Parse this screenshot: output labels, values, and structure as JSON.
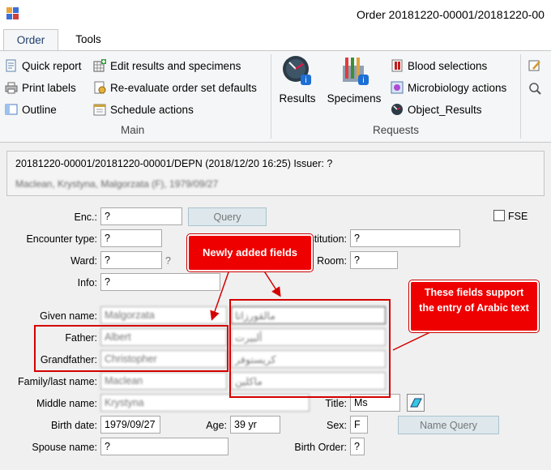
{
  "window": {
    "title": "Order 20181220-00001/20181220-00"
  },
  "tabs": [
    {
      "label": "Order"
    },
    {
      "label": "Tools"
    }
  ],
  "ribbon": {
    "main": {
      "label": "Main",
      "items": [
        "Quick report",
        "Print labels",
        "Outline",
        "Edit results and specimens",
        "Re-evaluate order set defaults",
        "Schedule actions"
      ]
    },
    "requests": {
      "label": "Requests",
      "results": "Results",
      "specimens": "Specimens",
      "items": [
        "Blood selections",
        "Microbiology actions",
        "Object_Results"
      ]
    }
  },
  "order": {
    "info_line": "20181220-00001/20181220-00001/DEPN (2018/12/20 16:25) Issuer: ?",
    "patient_line": "Maclean, Krystyna, Malgorzata (F), 1979/09/27"
  },
  "form": {
    "enc_label": "Enc.:",
    "enc_value": "?",
    "query_button": "Query",
    "fse_label": "FSE",
    "encounter_type_label": "Encounter type:",
    "encounter_type_value": "?",
    "institution_label": "Institution:",
    "institution_value": "?",
    "ward_label": "Ward:",
    "ward_value": "?",
    "ward_extra": "?",
    "room_label": "Room:",
    "room_value": "?",
    "info_label": "Info:",
    "info_value": "?",
    "given_name_label": "Given name:",
    "given_name_value": "Malgorzata",
    "given_name_arabic": "مالقورزاتا",
    "father_label": "Father:",
    "father_value": "Albert",
    "father_arabic": "ألبيرت",
    "grandfather_label": "Grandfather:",
    "grandfather_value": "Christopher",
    "grandfather_arabic": "كريستوفر",
    "family_label": "Family/last name:",
    "family_value": "Maclean",
    "family_arabic": "ماكلين",
    "middle_label": "Middle name:",
    "middle_value": "Krystyna",
    "title_label": "Title:",
    "title_value": "Ms",
    "birth_label": "Birth date:",
    "birth_value": "1979/09/27",
    "age_label": "Age:",
    "age_value": "39 yr",
    "sex_label": "Sex:",
    "sex_value": "F",
    "name_query_button": "Name Query",
    "spouse_label": "Spouse name:",
    "spouse_value": "?",
    "birth_order_label": "Birth Order:",
    "birth_order_value": "?"
  },
  "annotations": {
    "new_fields": "Newly added fields",
    "arabic_note": "These fields support the entry of Arabic text"
  }
}
